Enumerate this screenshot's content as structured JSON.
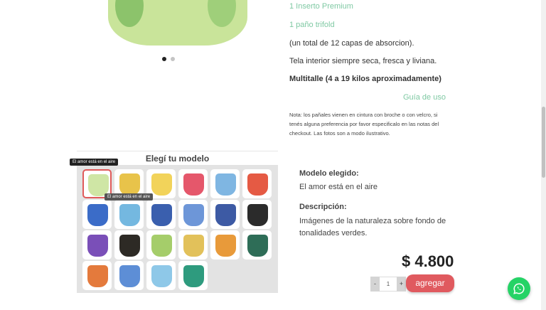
{
  "gallery": {
    "dot_count": 2,
    "active_dot": 0
  },
  "description": {
    "line1": "1 Inserto Premium",
    "line2": "1 paño trifold",
    "line3": "(un total de 12 capas de absorcion).",
    "line4": "Tela interior siempre seca, fresca y liviana.",
    "line5": "Multitalle (4 a 19 kilos aproximadamente)",
    "guide_link": "Guía de uso",
    "note": "Nota: los pañales vienen en cintura con broche o con velcro, si tenés alguna preferencia por favor especificalo en las notas del checkout. Las fotos son a modo ilustrativo."
  },
  "picker": {
    "title": "Elegí tu modelo",
    "tooltip_top": "El amor está en el aire",
    "tooltip_hover": "El amor está en el aire",
    "selected_index": 0,
    "swatch_colors": [
      "#cfe6a5",
      "#e8c34a",
      "#f2d35a",
      "#e5576b",
      "#7fb6e2",
      "#e55a44",
      "#3b6cc8",
      "#74b8e0",
      "#3a5fae",
      "#6d96d8",
      "#3d5aa4",
      "#2b2b2b",
      "#7a4fb8",
      "#2d2a25",
      "#a5cd6a",
      "#e2c15a",
      "#e89a3a",
      "#2e6d57",
      "#e47a3c",
      "#5d8ed6",
      "#8ec8e8",
      "#2e9b7e"
    ]
  },
  "model_info": {
    "model_label": "Modelo elegido:",
    "model_value": "El amor está en el aire",
    "desc_label": "Descripción:",
    "desc_value": "Imágenes de la naturaleza sobre fondo de tonalidades verdes."
  },
  "purchase": {
    "price": "$ 4.800",
    "minus": "-",
    "quantity": "1",
    "plus": "+",
    "add_label": "agregar"
  },
  "colors": {
    "accent_green": "#7fc9a3",
    "add_button": "#e05a5f",
    "whatsapp": "#25d366"
  }
}
